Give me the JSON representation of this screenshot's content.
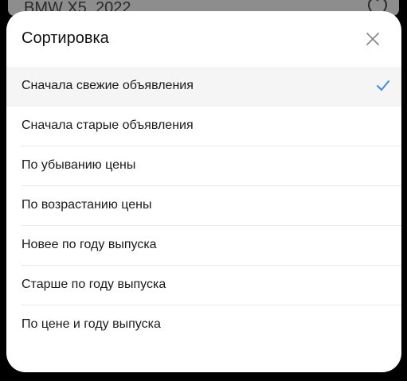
{
  "background": {
    "listing_title": "BMW X5, 2022"
  },
  "sort_sheet": {
    "title": "Сортировка",
    "options": [
      {
        "label": "Сначала свежие объявления",
        "selected": true
      },
      {
        "label": "Сначала старые объявления",
        "selected": false
      },
      {
        "label": "По убыванию цены",
        "selected": false
      },
      {
        "label": "По возрастанию цены",
        "selected": false
      },
      {
        "label": "Новее по году выпуска",
        "selected": false
      },
      {
        "label": "Старше по году выпуска",
        "selected": false
      },
      {
        "label": "По цене и году выпуска",
        "selected": false
      }
    ]
  },
  "colors": {
    "accent_check": "#3b8beb",
    "selected_row_bg": "#f5f5f5"
  },
  "icons": {
    "close": "close-icon",
    "check": "checkmark-icon",
    "favorite": "heart-icon"
  }
}
